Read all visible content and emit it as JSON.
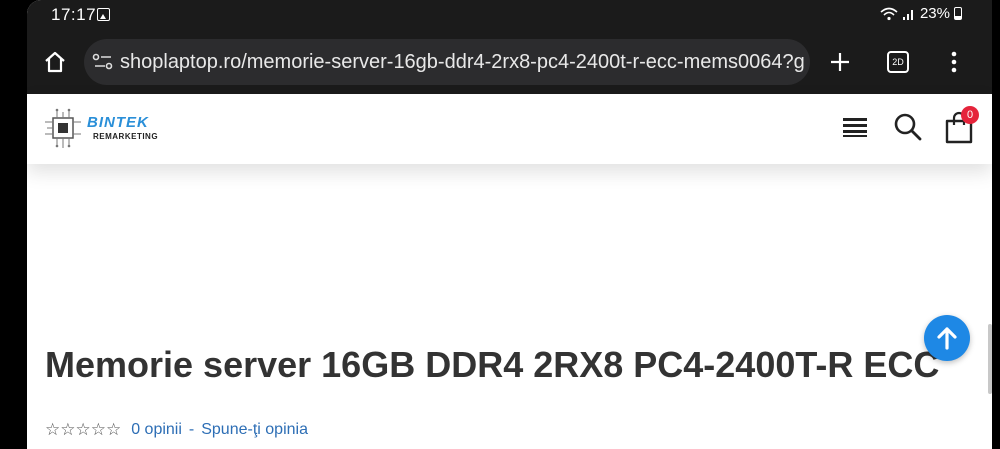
{
  "status_bar": {
    "time": "17:17",
    "battery": "23%"
  },
  "browser": {
    "url": "shoplaptop.ro/memorie-server-16gb-ddr4-2rx8-pc4-2400t-r-ecc-mems0064?g",
    "tab_count": "2D"
  },
  "site": {
    "logo_name": "BINTEK",
    "logo_sub": "REMARKETING",
    "cart_count": "0"
  },
  "product": {
    "title": "Memorie server 16GB DDR4 2RX8 PC4-2400T-R ECC",
    "stars": "☆☆☆☆☆",
    "reviews_link": "0 opinii",
    "separator": "-",
    "write_review_link": "Spune-ţi opinia"
  },
  "colors": {
    "accent": "#1e88e5",
    "link": "#2d6eb5",
    "badge": "#e5243b",
    "title": "#333333"
  }
}
